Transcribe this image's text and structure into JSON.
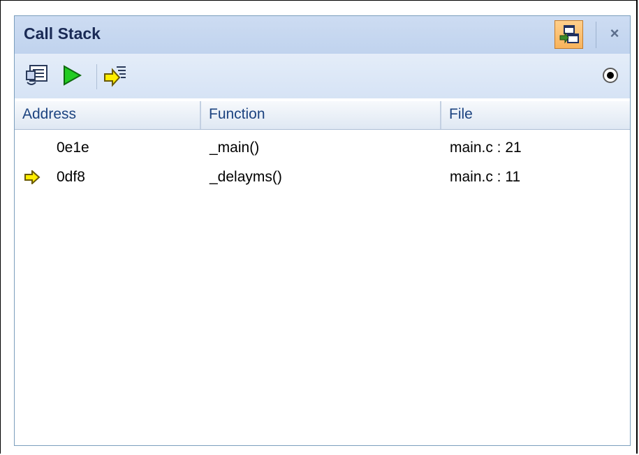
{
  "panel": {
    "title": "Call Stack",
    "close_glyph": "×",
    "title_icons": [
      "float-window-icon"
    ]
  },
  "toolbar": {
    "buttons": [
      "show-disassembly-icon",
      "run-to-cursor-icon",
      "set-next-statement-icon"
    ],
    "radio_selected": true
  },
  "table": {
    "columns": [
      "Address",
      "Function",
      "File"
    ],
    "rows": [
      {
        "address": "0e1e",
        "function": "_main()",
        "file": "main.c : 21",
        "current": false
      },
      {
        "address": "0df8",
        "function": "_delayms()",
        "file": "main.c : 11",
        "current": true
      }
    ]
  },
  "colors": {
    "title_bg": "#c0d3ee",
    "accent_orange": "#f8b35c",
    "current_arrow": "#ffee00",
    "header_text": "#1c4380"
  }
}
